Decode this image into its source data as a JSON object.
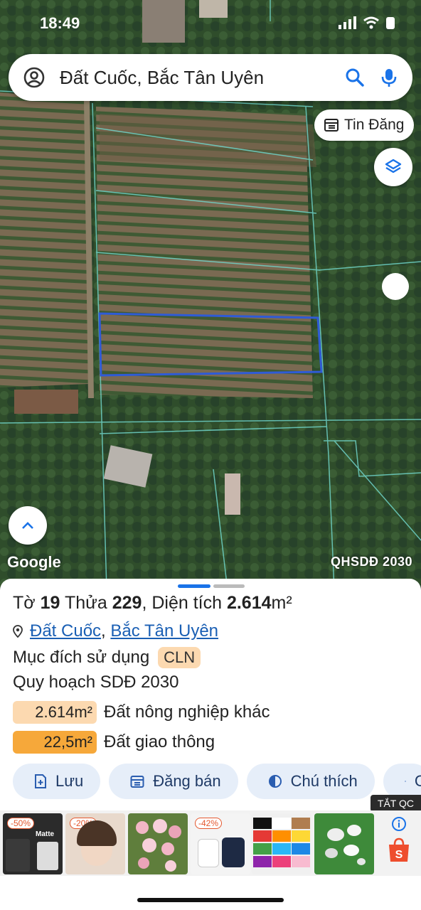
{
  "status": {
    "time": "18:49"
  },
  "search": {
    "query": "Đất Cuốc, Bắc Tân Uyên"
  },
  "map": {
    "tin_dang_label": "Tin Đăng",
    "google_label": "Google",
    "layer_badge": "QHSDĐ 2030"
  },
  "parcel": {
    "title_prefix": "Tờ",
    "sheet_no": "19",
    "parcel_word": "Thửa",
    "parcel_no": "229",
    "area_label": ", Diện tích",
    "area_value": "2.614",
    "area_unit": "m²",
    "location_part1": "Đất Cuốc",
    "location_sep": ",",
    "location_part2": "Bắc Tân Uyên",
    "purpose_label": "Mục đích sử dụng",
    "purpose_code": "CLN",
    "plan_label": "Quy hoạch SDĐ 2030",
    "plan_items": [
      {
        "value": "2.614m²",
        "label": "Đất nông nghiệp khác",
        "color": "#fcd9b0"
      },
      {
        "value": "22,5m²",
        "label": "Đất giao thông",
        "color": "#f6a83a"
      }
    ]
  },
  "actions": [
    {
      "label": "Lưu",
      "icon": "bookmark-add-icon"
    },
    {
      "label": "Đăng bán",
      "icon": "calendar-icon"
    },
    {
      "label": "Chú thích",
      "icon": "half-circle-icon"
    },
    {
      "label": "C",
      "icon": "camera-icon"
    }
  ],
  "ad": {
    "close_label": "TẮT QC",
    "items": [
      {
        "discount": "-50%",
        "caption": "Matte"
      },
      {
        "discount": "-20%",
        "caption": ""
      },
      {
        "discount": "",
        "caption": ""
      },
      {
        "discount": "-42%",
        "caption": ""
      },
      {
        "discount": "",
        "caption": ""
      },
      {
        "discount": "",
        "caption": ""
      }
    ]
  },
  "colors": {
    "accent": "#1a73e8",
    "link": "#1a5fb4",
    "parcel_outline": "#2f5bd6",
    "cadastral_lines": "#6fd3c8"
  }
}
